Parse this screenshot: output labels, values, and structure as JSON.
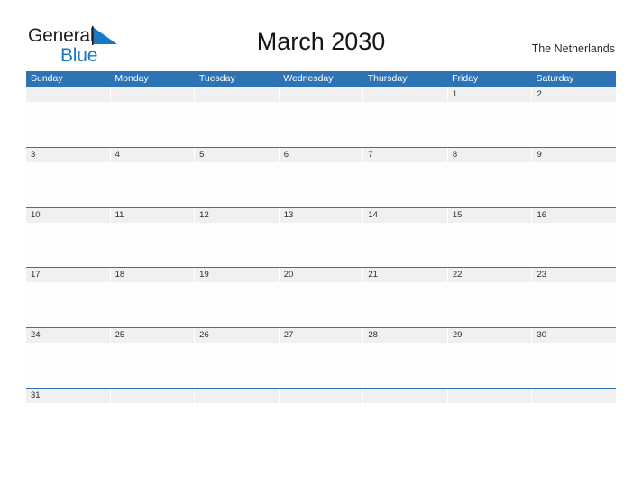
{
  "brand": {
    "name_part1": "General",
    "name_part2": "Blue",
    "flag_icon": "blue-triangle-flag-icon"
  },
  "header": {
    "title": "March 2030",
    "region": "The Netherlands"
  },
  "colors": {
    "header_blue": "#2e74b5",
    "brand_blue": "#1878c4",
    "date_strip_gray": "#f0f0f0",
    "page_background": "#ffffff"
  },
  "calendar": {
    "month": "March",
    "year": "2030",
    "weekday_headers": [
      "Sunday",
      "Monday",
      "Tuesday",
      "Wednesday",
      "Thursday",
      "Friday",
      "Saturday"
    ],
    "weeks": [
      [
        "",
        "",
        "",
        "",
        "",
        "1",
        "2"
      ],
      [
        "3",
        "4",
        "5",
        "6",
        "7",
        "8",
        "9"
      ],
      [
        "10",
        "11",
        "12",
        "13",
        "14",
        "15",
        "16"
      ],
      [
        "17",
        "18",
        "19",
        "20",
        "21",
        "22",
        "23"
      ],
      [
        "24",
        "25",
        "26",
        "27",
        "28",
        "29",
        "30"
      ],
      [
        "31",
        "",
        "",
        "",
        "",
        "",
        ""
      ]
    ]
  }
}
